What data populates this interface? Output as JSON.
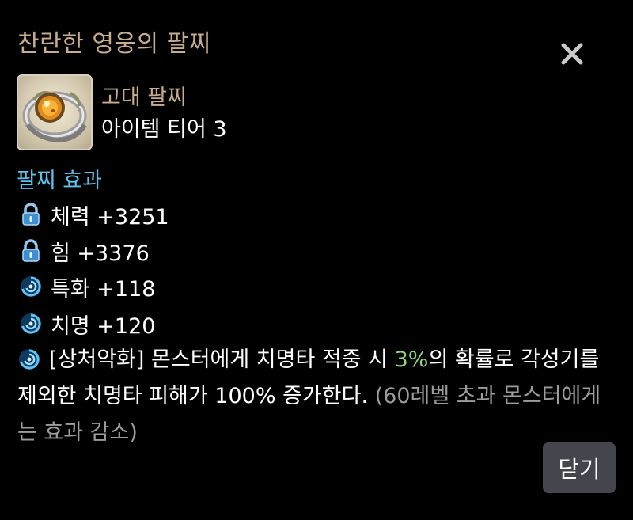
{
  "popup": {
    "title": "찬란한 영웅의 팔찌",
    "close_icon": "close-icon",
    "confirm_label": "닫기"
  },
  "item": {
    "icon": "bracelet-item-icon",
    "grade": "고대 팔찌",
    "tier": "아이템 티어 3"
  },
  "effects": {
    "section_title": "팔찌 효과",
    "stats": [
      {
        "icon": "lock-icon",
        "text": "체력 +3251"
      },
      {
        "icon": "lock-icon",
        "text": "힘 +3376"
      },
      {
        "icon": "swirl-icon",
        "text": "특화 +118"
      },
      {
        "icon": "swirl-icon",
        "text": "치명 +120"
      }
    ],
    "special": {
      "icon": "swirl-icon",
      "text_before": "[상처악화] 몬스터에게 치명타 적중 시 ",
      "highlight": "3%",
      "text_after": "의 확률로 각성기를 제외한 치명타 피해가 100% 증가한다. ",
      "note": "(60레벨 초과 몬스터에게는 효과 감소)"
    }
  },
  "colors": {
    "background": "#000000",
    "title": "#c8ad8c",
    "section_title": "#5ec3ea",
    "highlight": "#8fd87a",
    "note": "#9c9c9c",
    "button_bg": "#45464d"
  }
}
